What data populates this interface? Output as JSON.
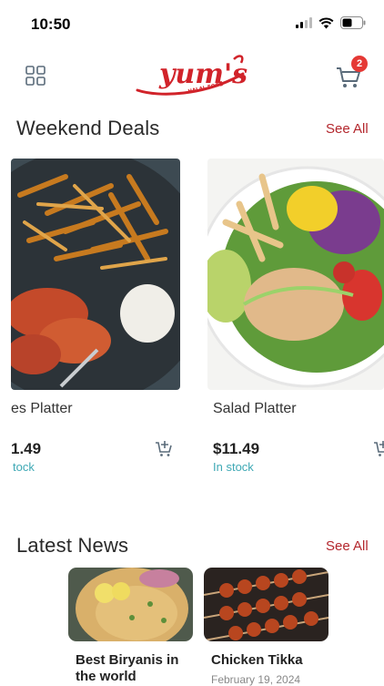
{
  "status": {
    "time": "10:50"
  },
  "header": {
    "logo_text": "yum's",
    "logo_subtext": "HALAL FOOD",
    "cart_count": "2",
    "icons": [
      "grid-icon",
      "cart-icon"
    ]
  },
  "weekend_deals": {
    "title": "Weekend Deals",
    "see_all": "See All",
    "items": [
      {
        "name": "es Platter",
        "price": "1.49",
        "stock": "tock"
      },
      {
        "name": "Salad Platter",
        "price": "$11.49",
        "stock": "In stock"
      }
    ]
  },
  "latest_news": {
    "title": "Latest News",
    "see_all": "See All",
    "items": [
      {
        "title": "Best Biryanis in the world",
        "date": ""
      },
      {
        "title": "Chicken Tikka",
        "date": "February 19, 2024"
      }
    ]
  },
  "colors": {
    "accent": "#b3262c",
    "stock": "#3fa9b5",
    "badge": "#e53935"
  }
}
